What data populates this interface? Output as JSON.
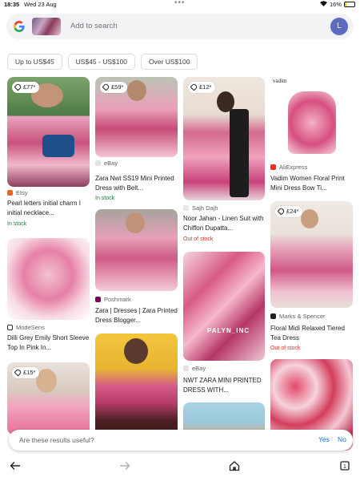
{
  "status": {
    "time": "18:35",
    "date": "Wed 23 Aug",
    "battery": "16%",
    "battery_level": 0.16
  },
  "search": {
    "placeholder": "Add to search",
    "avatar_letter": "L"
  },
  "filters": [
    "Up to US$45",
    "US$45 - US$100",
    "Over US$100"
  ],
  "results": [
    {
      "price": "£77*",
      "source": "Etsy",
      "title": "Pearl letters initial charm I initial necklace...",
      "stock": "In stock"
    },
    {
      "price": "",
      "source": "ModeSens",
      "title": "Dilli Grey Emily Short Sleeve Top In Pink In...",
      "stock": ""
    },
    {
      "price": "£15*",
      "source": "",
      "title": "",
      "stock": ""
    },
    {
      "price": "£59*",
      "source": "eBay",
      "title": "Zara Nwt SS19 Mini Printed Dress with Belt...",
      "stock": "In stock"
    },
    {
      "price": "",
      "source": "Poshmark",
      "title": "Zara | Dresses | Zara Printed Dress Blogger...",
      "stock": ""
    },
    {
      "price": "",
      "source": "",
      "title": "",
      "stock": ""
    },
    {
      "price": "£12*",
      "source": "Sajh Dajh",
      "title": "Noor Jahan - Linen Suit with Chiffon Dupatta...",
      "stock": "Out of stock"
    },
    {
      "price": "",
      "source": "eBay",
      "title": "NWT ZARA MINI PRINTED DRESS WITH...",
      "stock": "",
      "watermark": "PALYN_INC"
    },
    {
      "price": "",
      "source": "",
      "title": "",
      "stock": ""
    },
    {
      "price": "",
      "source": "AliExpress",
      "title": "Vadim Women Floral Print Mini Dress Bow Ti...",
      "stock": "",
      "brand_text": "vadim"
    },
    {
      "price": "£24*",
      "source": "Marks & Spencer",
      "title": "Floral Midi Relaxed Tiered Tea Dress",
      "stock": "Out of stock"
    },
    {
      "price": "",
      "source": "",
      "title": "",
      "stock": ""
    }
  ],
  "feedback": {
    "question": "Are these results useful?",
    "yes": "Yes",
    "no": "No"
  },
  "colors": {
    "in_stock": "#188038",
    "out_of_stock": "#d93025",
    "link": "#1a73e8",
    "accent_avatar": "#5c6bc0"
  }
}
